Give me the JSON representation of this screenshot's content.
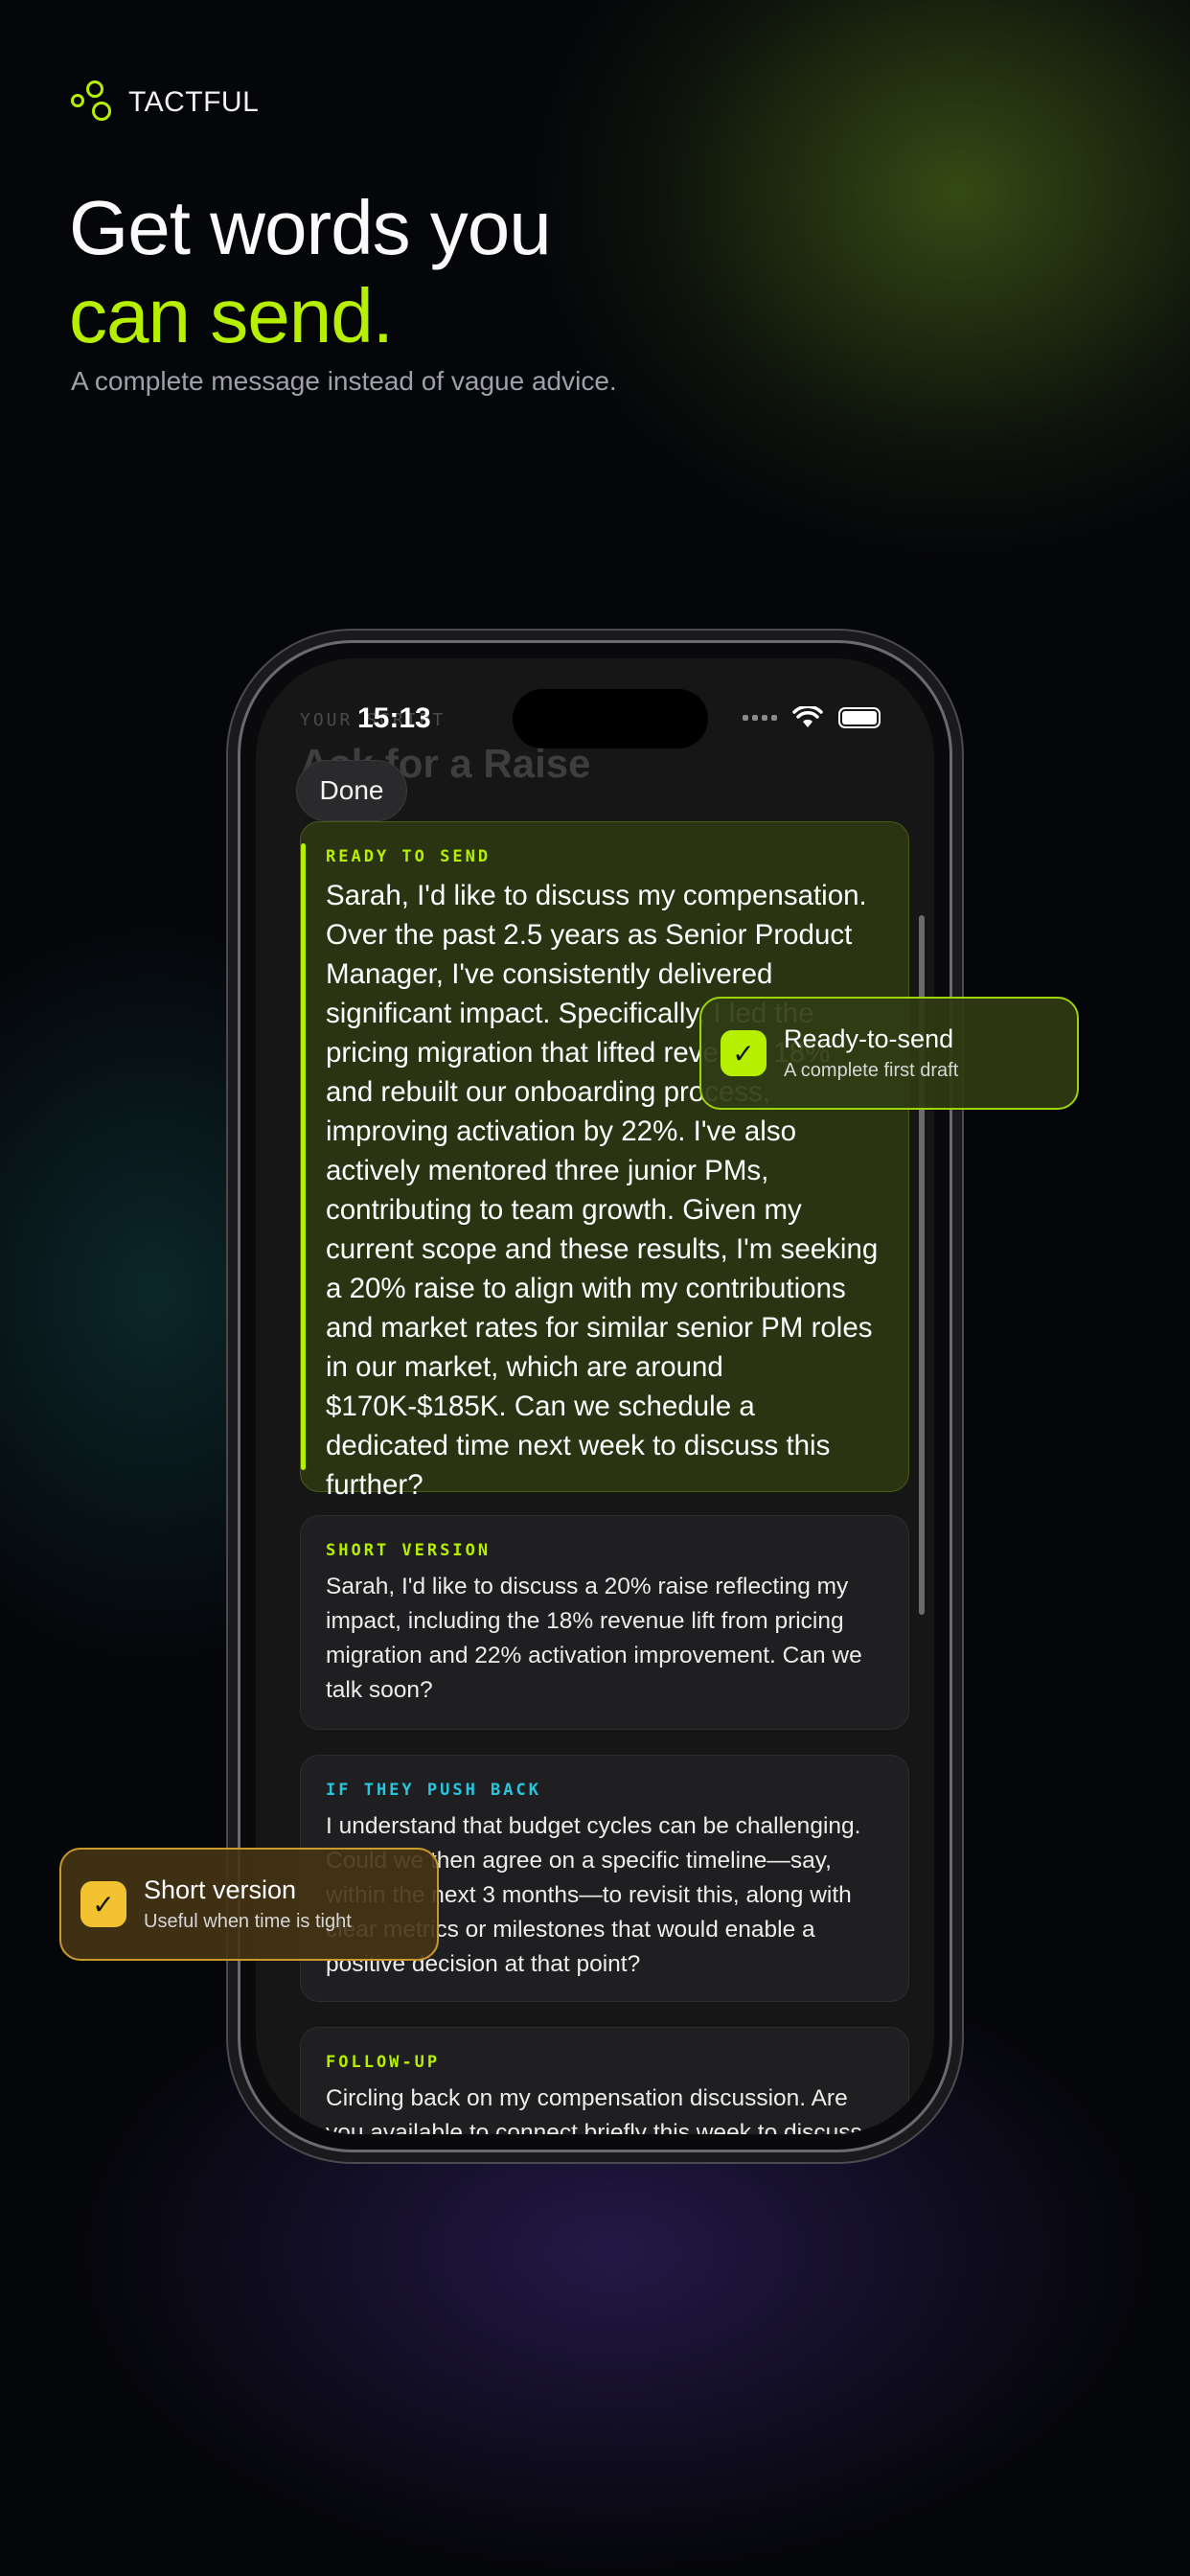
{
  "brand": {
    "name": "TACTFUL",
    "logo_icon": "dots-logo-icon",
    "accent": "#b6f000"
  },
  "hero": {
    "line1": "Get words you",
    "line2": "can send.",
    "subhead": "A complete message instead of vague advice."
  },
  "phone": {
    "status_time": "15:13",
    "header_label": "YOUR SCRIPT",
    "header_title": "Ask for a Raise",
    "done_label": "Done",
    "cards": [
      {
        "label": "READY TO SEND",
        "body": "Sarah, I'd like to discuss my compensation. Over the past 2.5 years as Senior Product Manager, I've consistently delivered significant impact. Specifically, I led the pricing migration that lifted revenue 18% and rebuilt our onboarding process, improving activation by 22%. I've also actively mentored three junior PMs, contributing to team growth. Given my current scope and these results, I'm seeking a 20% raise to align with my contributions and market rates for similar senior PM roles in our market, which are around $170K-$185K. Can we schedule a dedicated time next week to discuss this further?"
      },
      {
        "label": "SHORT VERSION",
        "body": "Sarah, I'd like to discuss a 20% raise reflecting my impact, including the 18% revenue lift from pricing migration and 22% activation improvement. Can we talk soon?"
      },
      {
        "label": "IF THEY PUSH BACK",
        "body": "I understand that budget cycles can be challenging. Could we then agree on a specific timeline—say, within the next 3 months—to revisit this, along with clear metrics or milestones that would enable a positive decision at that point?"
      },
      {
        "label": "FOLLOW-UP",
        "body": "Circling back on my compensation discussion. Are you available to connect briefly this week to discuss"
      }
    ]
  },
  "callouts": {
    "ready": {
      "title": "Ready-to-send",
      "subtitle": "A complete first draft",
      "color": "#b6f000"
    },
    "short": {
      "title": "Short version",
      "subtitle": "Useful when time is tight",
      "color": "#f2c230"
    }
  }
}
